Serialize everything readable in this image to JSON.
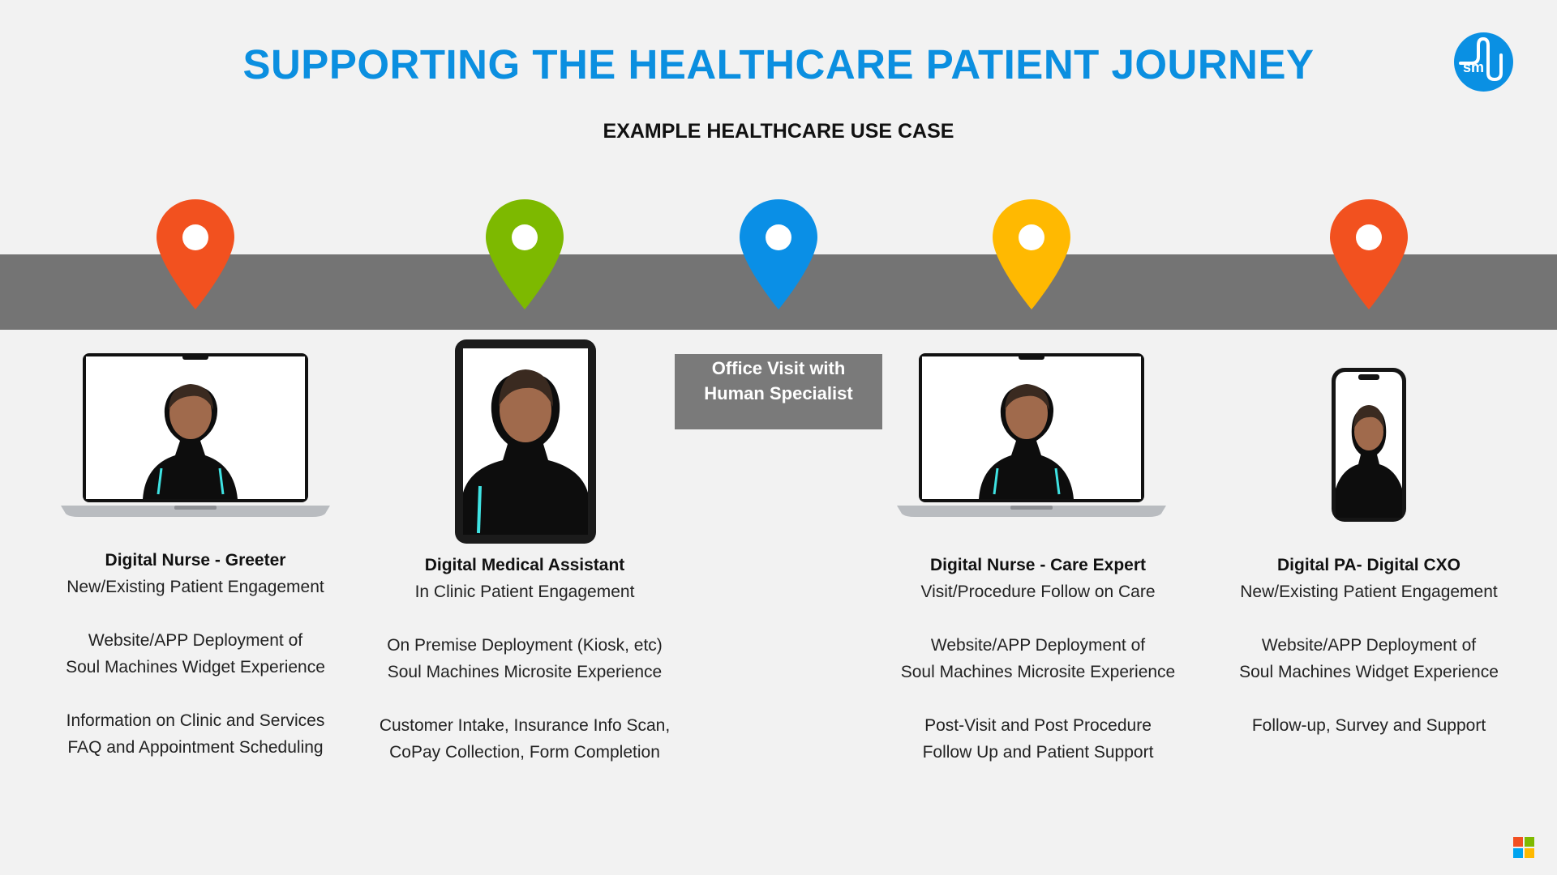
{
  "title": "SUPPORTING THE HEALTHCARE PATIENT JOURNEY",
  "subtitle": "EXAMPLE HEALTHCARE USE CASE",
  "logo": {
    "text": "sm",
    "color": "#0a90e3"
  },
  "band_color": "#747474",
  "steps": [
    {
      "pin_color": "#f2511f",
      "device": "laptop",
      "name": "Digital Nurse - Greeter",
      "tagline": "New/Existing Patient Engagement",
      "deployment": [
        "Website/APP Deployment of",
        "Soul Machines Widget Experience"
      ],
      "features": [
        "Information on Clinic and Services",
        "FAQ and Appointment Scheduling"
      ]
    },
    {
      "pin_color": "#7db900",
      "device": "tablet",
      "name": "Digital Medical Assistant",
      "tagline": "In Clinic Patient Engagement",
      "deployment": [
        "On Premise Deployment (Kiosk, etc)",
        "Soul Machines Microsite Experience"
      ],
      "features": [
        "Customer Intake, Insurance Info Scan,",
        "CoPay Collection, Form Completion"
      ]
    },
    {
      "pin_color": "#0a8fe6",
      "device": "none",
      "office_lines": [
        "Office Visit with",
        "Human Specialist"
      ]
    },
    {
      "pin_color": "#ffb901",
      "device": "laptop",
      "name": "Digital Nurse - Care Expert",
      "tagline": "Visit/Procedure Follow on Care",
      "deployment": [
        "Website/APP Deployment of",
        "Soul Machines Microsite Experience"
      ],
      "features": [
        "Post-Visit and Post Procedure",
        "Follow Up and Patient Support"
      ]
    },
    {
      "pin_color": "#f2511f",
      "device": "phone",
      "name": "Digital PA- Digital CXO",
      "tagline": "New/Existing Patient Engagement",
      "deployment": [
        "Website/APP Deployment of",
        "Soul Machines Widget Experience"
      ],
      "features": [
        "Follow-up, Survey and Support"
      ]
    }
  ]
}
